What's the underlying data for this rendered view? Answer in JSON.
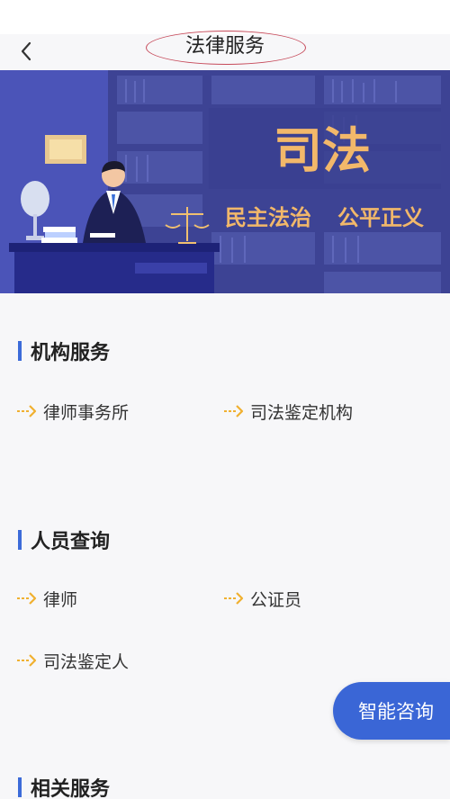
{
  "header": {
    "title": "法律服务"
  },
  "banner": {
    "main_text": "司法",
    "slogan_1": "民主法治",
    "slogan_2": "公平正义"
  },
  "sections": [
    {
      "title": "机构服务",
      "items": [
        {
          "label": "律师事务所"
        },
        {
          "label": "司法鉴定机构"
        }
      ]
    },
    {
      "title": "人员查询",
      "items": [
        {
          "label": "律师"
        },
        {
          "label": "公证员"
        },
        {
          "label": "司法鉴定人"
        }
      ]
    },
    {
      "title": "相关服务"
    }
  ],
  "fab": {
    "label": "智能咨询"
  },
  "colors": {
    "accent": "#3c6bd9",
    "arrow": "#f0b030",
    "banner_bg": "#3d4394",
    "banner_text": "#f2b86a"
  },
  "icons": {
    "back": "chevron-left-icon",
    "item_arrow": "dashed-arrow-icon"
  }
}
